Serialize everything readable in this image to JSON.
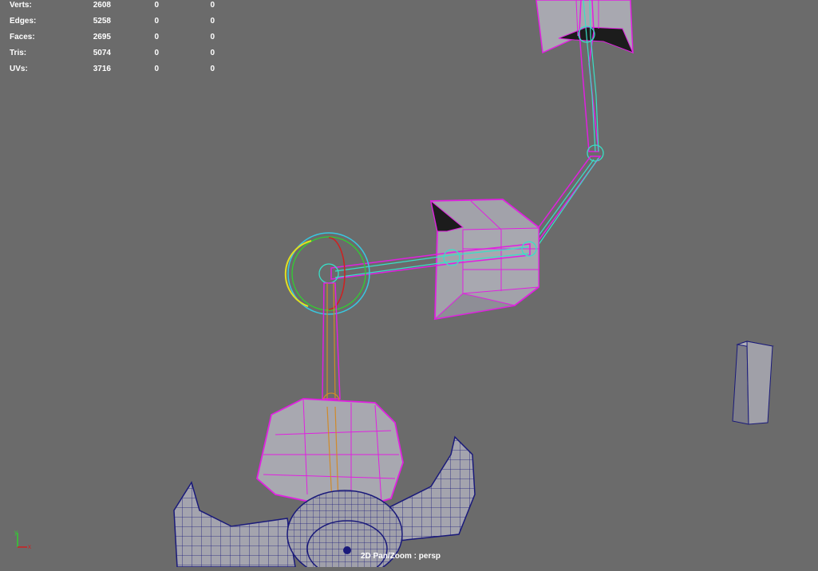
{
  "hud": {
    "rows": [
      {
        "label": "Verts:",
        "v1": "2608",
        "v2": "0",
        "v3": "0"
      },
      {
        "label": "Edges:",
        "v1": "5258",
        "v2": "0",
        "v3": "0"
      },
      {
        "label": "Faces:",
        "v1": "2695",
        "v2": "0",
        "v3": "0"
      },
      {
        "label": "Tris:",
        "v1": "5074",
        "v2": "0",
        "v3": "0"
      },
      {
        "label": "UVs:",
        "v1": "3716",
        "v2": "0",
        "v3": "0"
      }
    ]
  },
  "status": {
    "text": "2D Pan/Zoom : persp"
  },
  "axis": {
    "y_label": "y",
    "x_label": "x"
  },
  "colors": {
    "background": "#6b6b6b",
    "mesh_fill": "#9a9aa4",
    "selection_magenta": "#e020e0",
    "joint_cyan": "#38e0c8",
    "joint_orange": "#d08a2a",
    "wire_blue": "#1a1a7a",
    "manip_green": "#30d030",
    "manip_red": "#d02020",
    "manip_yellow": "#e0e020"
  }
}
